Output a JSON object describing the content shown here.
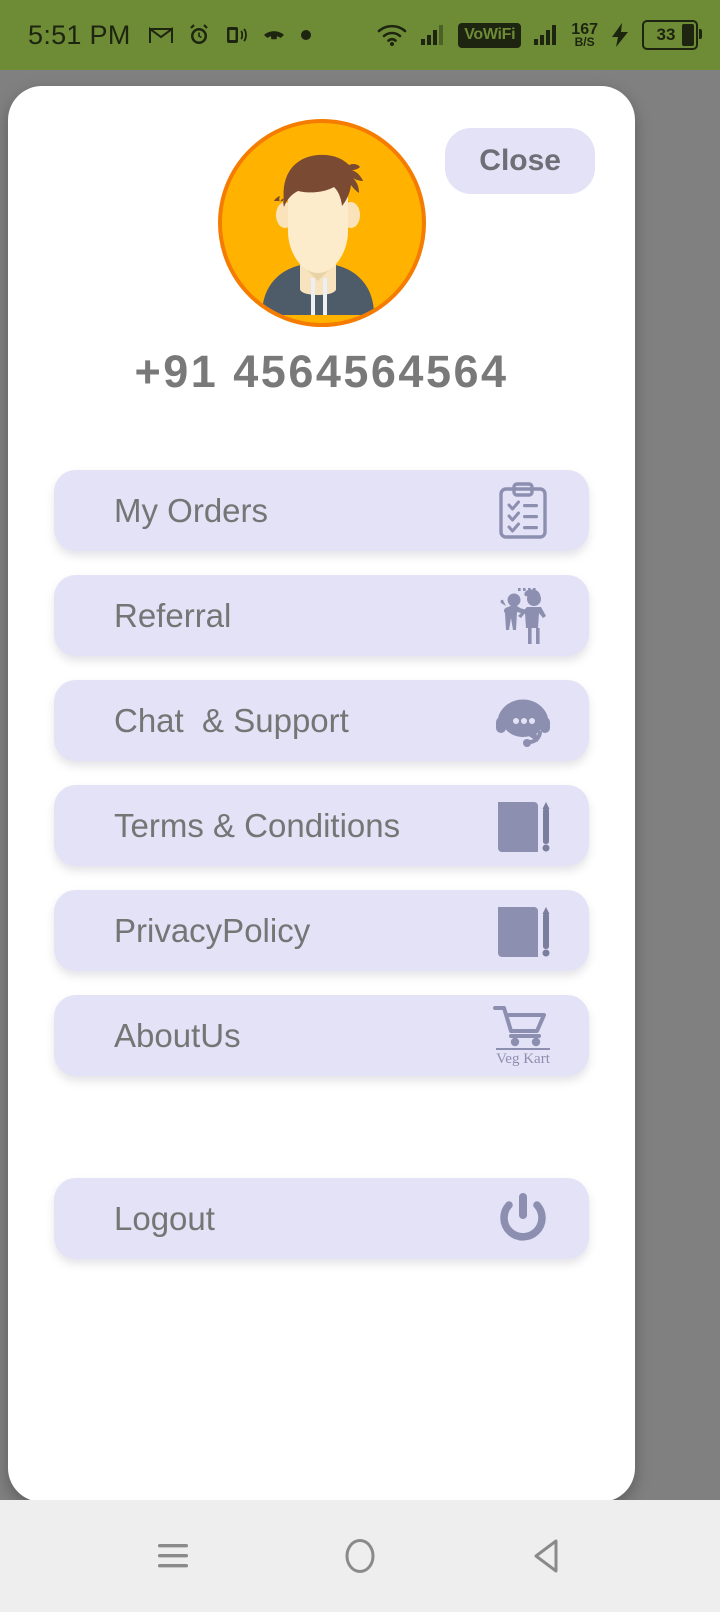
{
  "status_bar": {
    "time": "5:51 PM",
    "background_color": "#6e8b36",
    "left_icons": [
      "gmail-icon",
      "alarm-icon",
      "vibrate-icon",
      "missed-call-icon",
      "dot-icon"
    ],
    "wifi_icon": "wifi-icon",
    "signal_icon_1": "signal-bars-icon",
    "vowifi_label": "VoWiFi",
    "signal_icon_2": "signal-bars-icon",
    "data_rate_value": "167",
    "data_rate_unit": "B/S",
    "charging_icon": "charging-bolt-icon",
    "battery_percent": "33"
  },
  "card": {
    "avatar": "user-avatar",
    "close_label": "Close",
    "phone_number": "+91 4564564564",
    "accent_color": "#e3e2f6",
    "text_color": "#757575",
    "icon_color": "#8d8fb0",
    "avatar_bg": "#ffb300"
  },
  "menu": {
    "items": [
      {
        "label": "My Orders",
        "icon": "clipboard-checklist-icon"
      },
      {
        "label": "Referral",
        "icon": "two-people-icon"
      },
      {
        "label": "Chat  & Support",
        "icon": "headset-chat-icon"
      },
      {
        "label": "Terms & Conditions",
        "icon": "document-pen-icon"
      },
      {
        "label": "PrivacyPolicy",
        "icon": "document-pen-icon"
      },
      {
        "label": "AboutUs",
        "icon": "shopping-cart-icon",
        "brand": "Veg Kart"
      }
    ],
    "logout": {
      "label": "Logout",
      "icon": "power-icon"
    }
  },
  "nav_bar": {
    "recents": "recents-icon",
    "home": "home-icon",
    "back": "back-icon"
  }
}
